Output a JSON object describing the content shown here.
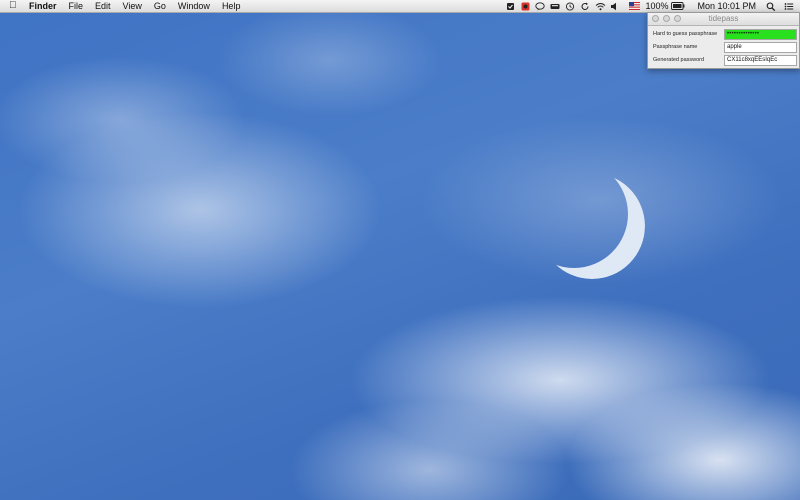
{
  "menubar": {
    "app_name": "Finder",
    "menus": [
      "File",
      "Edit",
      "View",
      "Go",
      "Window",
      "Help"
    ],
    "status": {
      "battery": "100%",
      "clock": "Mon 10:01 PM",
      "icons": [
        "dropbox-icon",
        "app-red-icon",
        "chat-icon",
        "keyboard-icon",
        "time-machine-icon",
        "sync-icon",
        "wifi-icon",
        "volume-icon",
        "flag-us-icon",
        "battery-icon",
        "spotlight-icon",
        "notification-center-icon"
      ]
    }
  },
  "window": {
    "title": "tidepass",
    "rows": [
      {
        "label": "Hard to guess passphrase",
        "value": "••••••••••••••"
      },
      {
        "label": "Passphrase name",
        "value": "apple"
      },
      {
        "label": "Generated password",
        "value": "CX11c8xqEEsIqEc"
      }
    ],
    "colors": {
      "passphrase_field": "#29e01f"
    }
  }
}
